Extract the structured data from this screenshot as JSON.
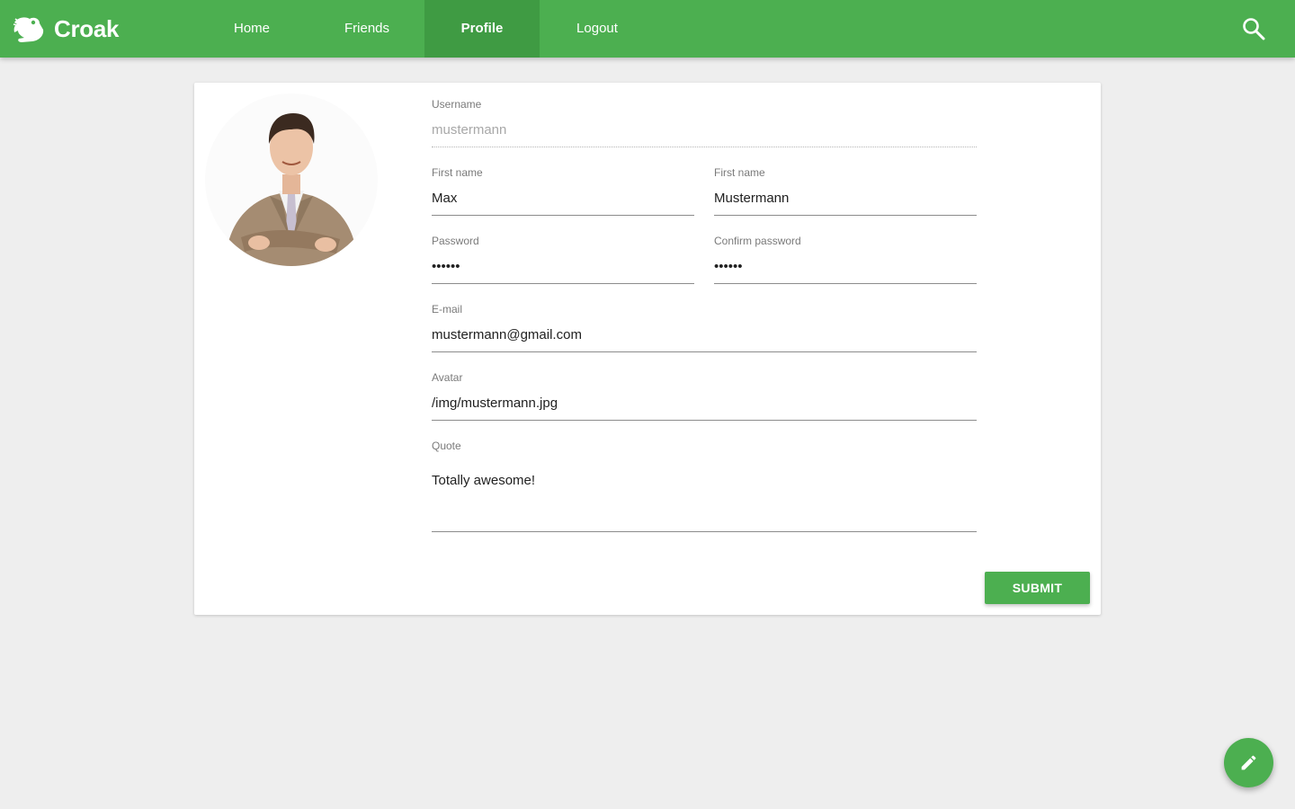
{
  "app": {
    "name": "Croak",
    "logo_icon": "frog-icon"
  },
  "nav": {
    "items": [
      {
        "label": "Home",
        "active": false
      },
      {
        "label": "Friends",
        "active": false
      },
      {
        "label": "Profile",
        "active": true
      },
      {
        "label": "Logout",
        "active": false
      }
    ],
    "search_icon": "search-icon"
  },
  "profile": {
    "avatar_icon": "avatar-photo",
    "fields": {
      "username": {
        "label": "Username",
        "value": "mustermann",
        "disabled": true
      },
      "first_name": {
        "label": "First name",
        "value": "Max"
      },
      "last_name": {
        "label": "First name",
        "value": "Mustermann"
      },
      "password": {
        "label": "Password",
        "value": "••••••"
      },
      "confirm_password": {
        "label": "Confirm password",
        "value": "••••••"
      },
      "email": {
        "label": "E-mail",
        "value": "mustermann@gmail.com"
      },
      "avatar": {
        "label": "Avatar",
        "value": "/img/mustermann.jpg"
      },
      "quote": {
        "label": "Quote",
        "value": "Totally awesome!"
      }
    },
    "submit_label": "SUBMIT"
  },
  "fab": {
    "icon": "pencil-icon"
  },
  "colors": {
    "primary": "#4caf50",
    "primary_dark": "#3f9b43",
    "background": "#eeeeee"
  }
}
